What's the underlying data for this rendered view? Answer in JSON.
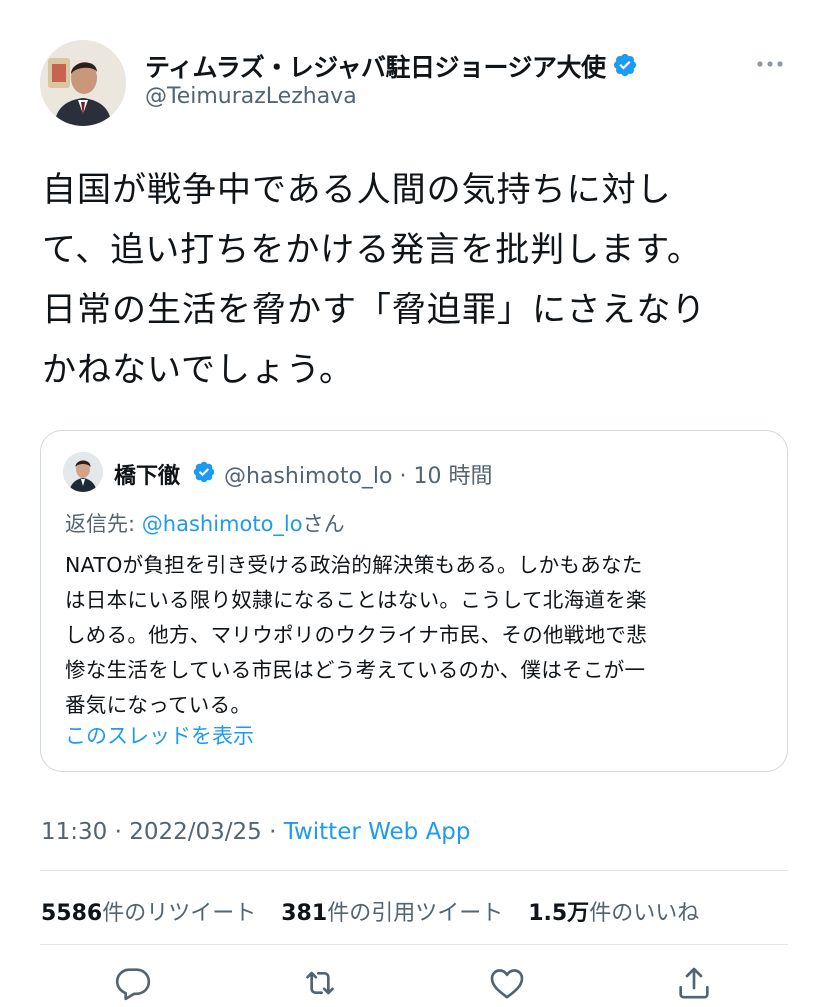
{
  "author": {
    "name": "ティムラズ・レジャバ駐日ジョージア大使",
    "handle": "@TeimurazLezhava",
    "verified": true
  },
  "tweet": {
    "lines": [
      "自国が戦争中である人間の気持ちに対し",
      "て、追い打ちをかける発言を批判します。",
      "日常の生活を脅かす「脅迫罪」にさえなり",
      "かねないでしょう。"
    ]
  },
  "quote": {
    "name": "橋下徹",
    "handle_time": "@hashimoto_lo · 10 時間",
    "reply_prefix": "返信先: ",
    "reply_mention": "@hashimoto_lo",
    "reply_suffix": "さん",
    "lines": [
      "NATOが負担を引き受ける政治的解決策もある。しかもあなた",
      "は日本にいる限り奴隷になることはない。こうして北海道を楽",
      "しめる。他方、マリウポリのウクライナ市民、その他戦地で悲",
      "惨な生活をしている市民はどう考えているのか、僕はそこが一",
      "番気になっている。"
    ],
    "show_thread": "このスレッドを表示"
  },
  "meta": {
    "time": "11:30 · 2022/03/25 · ",
    "source": "Twitter Web App"
  },
  "stats": {
    "retweets_count": "5586",
    "retweets_label": "件のリツイート",
    "quotes_count": "381",
    "quotes_label": "件の引用ツイート",
    "likes_count": "1.5万",
    "likes_label": "件のいいね"
  },
  "colors": {
    "accent": "#1d9bf0",
    "secondary_text": "#536471",
    "border": "#cfd9de"
  },
  "icons": [
    "verified-badge-icon",
    "more-icon",
    "reply-icon",
    "retweet-icon",
    "like-icon",
    "share-icon"
  ]
}
